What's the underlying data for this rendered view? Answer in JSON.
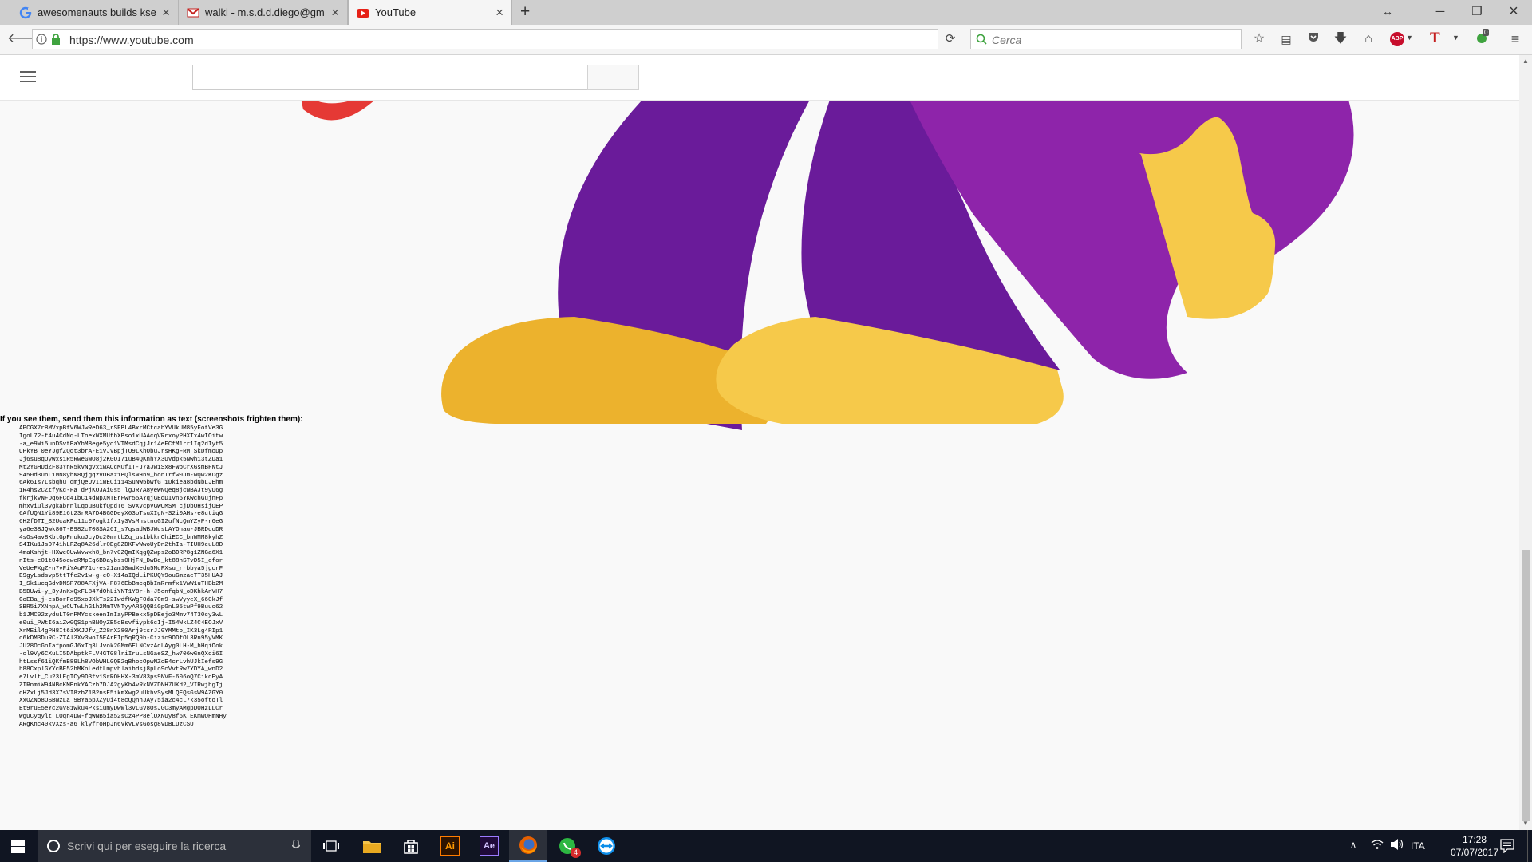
{
  "browser": {
    "tabs": [
      {
        "label": "awesomenauts builds ksenia",
        "favicon": "google-g-icon",
        "active": false
      },
      {
        "label": "walki - m.s.d.d.diego@gmail",
        "favicon": "gmail-icon",
        "active": false
      },
      {
        "label": "YouTube",
        "favicon": "youtube-icon",
        "active": true
      }
    ],
    "new_tab_symbol": "+",
    "url": "https://www.youtube.com",
    "search_placeholder": "Cerca",
    "adblock_label": "ABP",
    "translate_label": "T",
    "badge_count": "0"
  },
  "page": {
    "info_title": "If you see them, send them this information as text (screenshots frighten them):",
    "code_lines": [
      "APCGX7rBMVxpBfV6WJwReD63_rSFBL4BxrMCtcabYVUkUM85yFotVe3G",
      "IgoL72-f4u4CdNq-LToexWXMUfbXBso1xUAAcqVRrxoyPHXTx4wIOitw",
      "-a_e9Wi5unDSvtEaYhM8ege5yo1VTMsdCqjJr14eFCfM1rr1Iq2dIyt5",
      "UPkYB_0eYJgfZQqt3brA-E1vJVBpjTO9LKhObuJrsHKgFRM_SkDfmoDp",
      "Jj6su8qOyWxs1R5RweGWO8j2K0OI71uB4QKnhYX3UVdpk5Nwh13tZUa1",
      "Mt2YGHUdZF83YnR5kVNgvx1wAOcMufIT-J7aJw1Sx8FWbCrXGsmBFNtJ",
      "9450d3UnL1MN8yhN8QjgqzVOBaz1BQlsWHn9_honIrfw0Jm-wQw2KDgz",
      "6Ak6Is7Lsbqhu_dmjQeUvIiWECi114SuNW5bwfG_1Dkiea8bdNbLJEhm",
      "1R4hs2CZtfyKc-Fa_dPjKOJAiGs5_lgJR7A8yeWNQeq8jcWBAJt9yU6g",
      "fkrjkvNFDq6FCd4IbC14dNpXMTErFwr55AYqjGEdDIvn6YKwchGujnFp",
      "mhxViul3ygkabrnlLqouBukfQpdT6_SVXVcpVGWUMSM_cjDbUHsijOEP",
      "6AfUQN1Yi89E16t23rRA7D4BGGDeyX63oTsuXIgN-S2i0AHs-e8ctiqG",
      "6H2fDTI_S2UcaKFc11c07ogk1fx1y3VsMhstnuGI2ufNcQmYZyP-r6eG",
      "ya6e3BJQwk86T-E982cT08SA26I_s7qsadWBJWqsLAYOhau-JBRDcoDR",
      "4sOs4av8KbtGpFnukuJcyDc20mrtbZq_us1bkknOhiECC_bnWMM8kyhZ",
      "S4IKu1JsD741hLFZq8A26dlr0Eg8ZDKFvWwoUyDn2thIa-TIUH9euL8D",
      "4maKshjt-HXweCUwWvwxh8_bn7v0ZQmIKqgQZwps2oBDRP8g1ZNGa6X1",
      "nIts-e01t045ocweRMpEg6BDaybss0HjFN_DwBd_kt88hSTvD5I_ofor",
      "VeUeFXgZ-n7vFiYAuF71c-es21am10wdXedu5MdFXsu_rrbbya5jgcrF",
      "E9gyLsdsvp5ttTfe2v1w-g-eO-X14aIQdLiPKUQY9ouGmzaeTT35HUAJ",
      "I_Sk1ucqGdvDMSP788AFXjVA-P876EbBmcqBbImRrmfx1VwW1uTHBb2M",
      "B5DUwi-y_3yJnKxQxFL847dOhLiYNT1Y8r-h-J5cnfqbN_oDKhkAnVH7",
      "GoEBa_j-esBorFd95xoJXkTs22IwdfKWgF0da7Cm9-swVyyeX_660kJf",
      "SBR5i7XNnpA_wCUTwLhG1h2MmTVNTyyAR5QQB1GpGnL05twPf9Buuc62",
      "b1JMC02zyduLT0nPMYcskeenImIayPPBekx5pDEejo3Mmv74T30cy3wL",
      "e0ui_PWtI6aiZw0QS1phBNOyZE5cBsvfiypk6cIj-I54WkLZ4C4EOJxV",
      "XrMEil4gPH8It6iXKJJfv_Z28nX280Arj9tsrJJ0YMMto_IK3Lg4RIp1",
      "c6kDM3DuRC-ZTAl3Xv3woI5EArEIp5qRQ9b-Cizic9ODfOL3Rn95yVMK",
      "JU28OcGnIafpomGJ6xTq3LJvok2GMm6ELNCvzAqLAyg0LH-M_hHqiOok",
      "-cl9Vy6CXuLI5DAbptkFLV4GT08lriIruLsNGaeSZ_hw706wGnQXdi6I",
      "htLssf61iQKfmB89Lh8VObWHL0QE2qBhocOpwNZcE4crLvhUJkIefs9G",
      "h88CxplGYYcBE52hMKoLedtLmpvhlaibdsj8pLo9cVvtRw7YDYA_wnD2",
      "e7Lvlt_Cu23LEgTCy9D3fv1SrROHHX-3mV83ps9NVF-606oQ7CikdEyA",
      "ZIRnmiW94NBcKMEnkYACzh7DJA2gyKh4vRkNVZDNH7UKd2_VIRwjbgIj",
      "qHZxLj5Jd3X7sVI8zbZ1B2nsE5ikmXwg2uUkhvSysMLQEQsGsW9AZGY0",
      "XxOZNo8OSBWzLa_9BYa5pXZyUi4t8cQQnhJAy75ia2c4cL7k35oftoTl",
      "Et9ruE5eYc2GV81wku4PksiumyDwWl3vLGV8OsJGC3myAMgpDOHzLLCr",
      "WgUCyqylt LOqn4Dw-fqWNB5ia52sCz4PP8elUXNUy8f6K_EKmwOHmNHy",
      "ARgKnc40kvXzs-a6_klyfroHpJn6VkVLVsGosg8vDBLUzCSU"
    ]
  },
  "taskbar": {
    "search_placeholder": "Scrivi qui per eseguire la ricerca",
    "language": "ITA",
    "time": "17:28",
    "date": "07/07/2017",
    "whatsapp_badge": "4",
    "ai_label": "Ai",
    "ae_label": "Ae"
  },
  "colors": {
    "purple_dark": "#6a1b9a",
    "purple_light": "#8e24aa",
    "yellow_dark": "#ecb22d",
    "yellow_light": "#f6c94a",
    "red": "#e53935"
  }
}
